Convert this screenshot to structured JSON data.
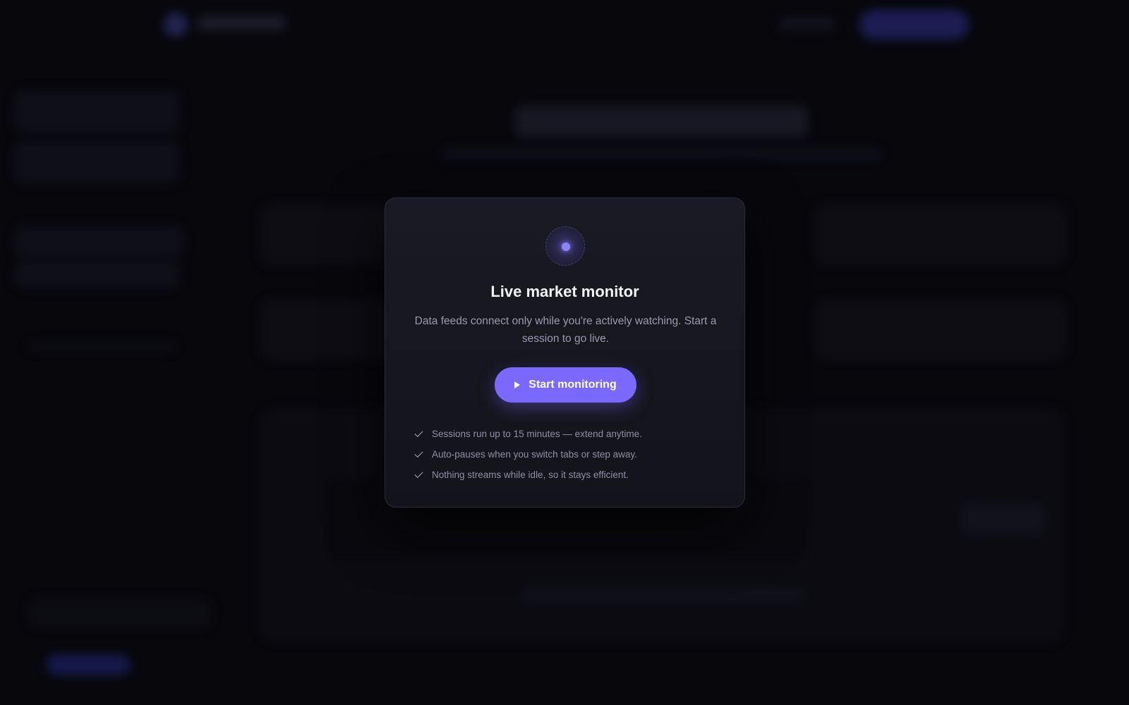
{
  "modal": {
    "title": "Live market monitor",
    "description": "Data feeds connect only while you're actively watching. Start a session to go live.",
    "start_button_label": "Start monitoring",
    "features": [
      "Sessions run up to 15 minutes — extend anytime.",
      "Auto-pauses when you switch tabs or step away.",
      "Nothing streams while idle, so it stays efficient."
    ],
    "icons": {
      "status": "live-pulse-icon",
      "button": "play-icon",
      "feature": "check-icon"
    }
  },
  "colors": {
    "accent": "#7b68ff",
    "background": "#07070c",
    "modal_surface": "#1a1a24"
  }
}
